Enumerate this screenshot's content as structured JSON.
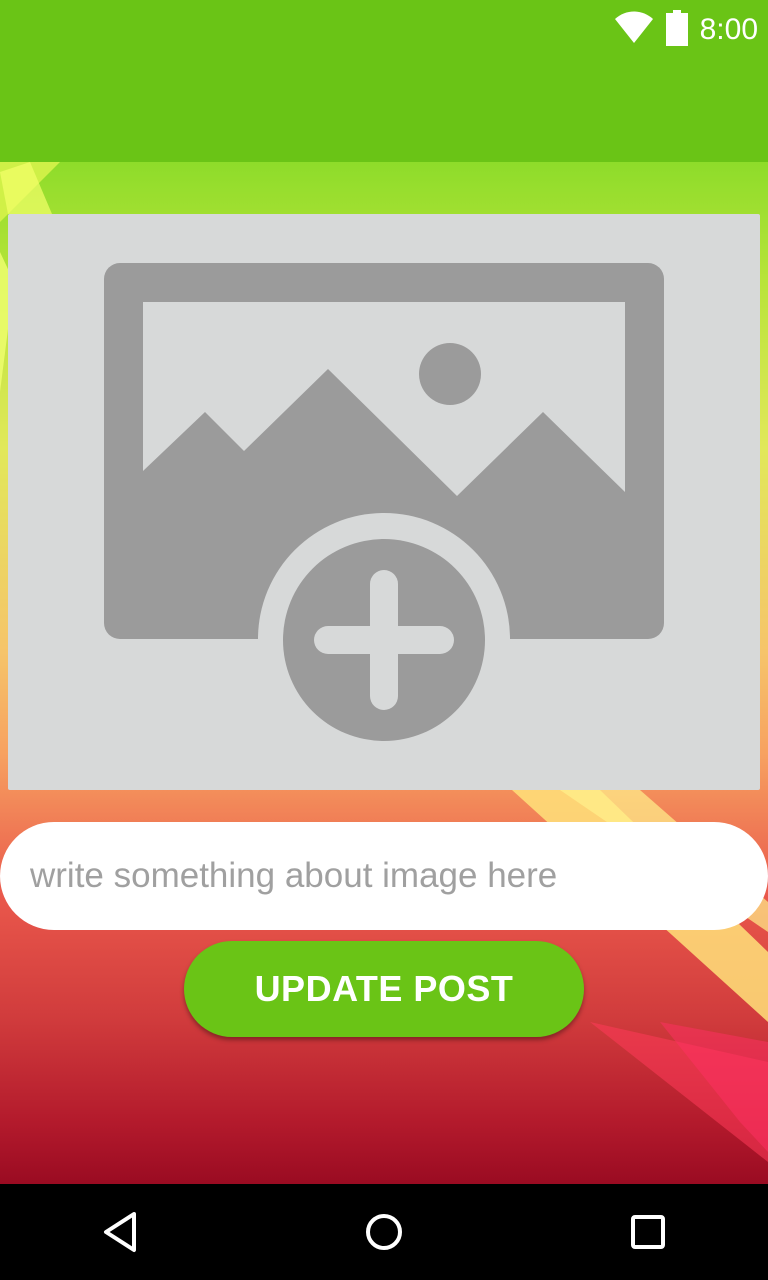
{
  "status_bar": {
    "time": "8:00",
    "icons": [
      "wifi-icon",
      "battery-icon"
    ]
  },
  "app_bar": {
    "color": "#6ac416"
  },
  "image_picker": {
    "icon": "add-photo-icon",
    "background": "#d7d9d9",
    "icon_color": "#9b9b9b"
  },
  "caption": {
    "placeholder": "write something about image here",
    "value": ""
  },
  "actions": {
    "update_label": "UPDATE POST"
  },
  "nav_bar": {
    "items": [
      "back-icon",
      "home-icon",
      "recents-icon"
    ]
  }
}
